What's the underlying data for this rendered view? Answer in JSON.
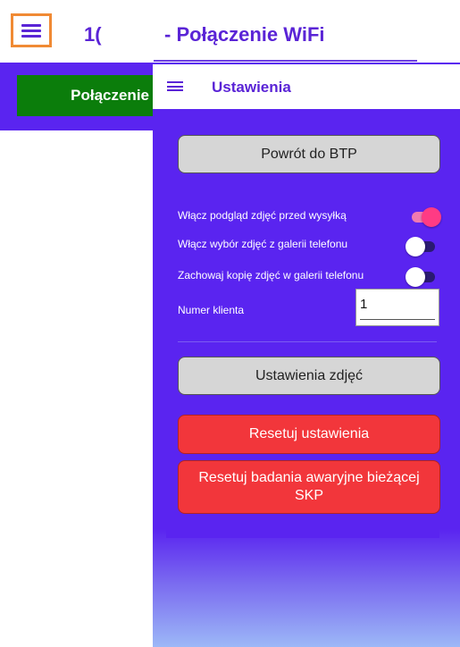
{
  "header": {
    "title_prefix": "1(",
    "title": "- Połączenie WiFi"
  },
  "background": {
    "connect_button": "Połączenie"
  },
  "drawer": {
    "title": "Ustawienia",
    "back_button": "Powrót do BTP",
    "settings": [
      {
        "label": "Włącz podgląd zdjęć przed wysyłką",
        "state": "on"
      },
      {
        "label": "Włącz wybór zdjęć z galerii telefonu",
        "state": "off"
      },
      {
        "label": "Zachowaj kopię zdjęć w galerii telefonu",
        "state": "off"
      }
    ],
    "client_number_label": "Numer klienta",
    "client_number_value": "1",
    "photo_settings_button": "Ustawienia zdjęć",
    "reset_settings_button": "Resetuj ustawienia",
    "reset_emergency_button": "Resetuj badania awaryjne bieżącej SKP"
  },
  "colors": {
    "accent": "#5a24d6",
    "drawer_bg": "#5a24f0",
    "menu_highlight": "#f08a34",
    "connect_green": "#0b7d0b",
    "danger": "#f2363b",
    "toggle_on": "#ff3b84"
  },
  "icons": {
    "menu": "hamburger-menu-icon"
  }
}
